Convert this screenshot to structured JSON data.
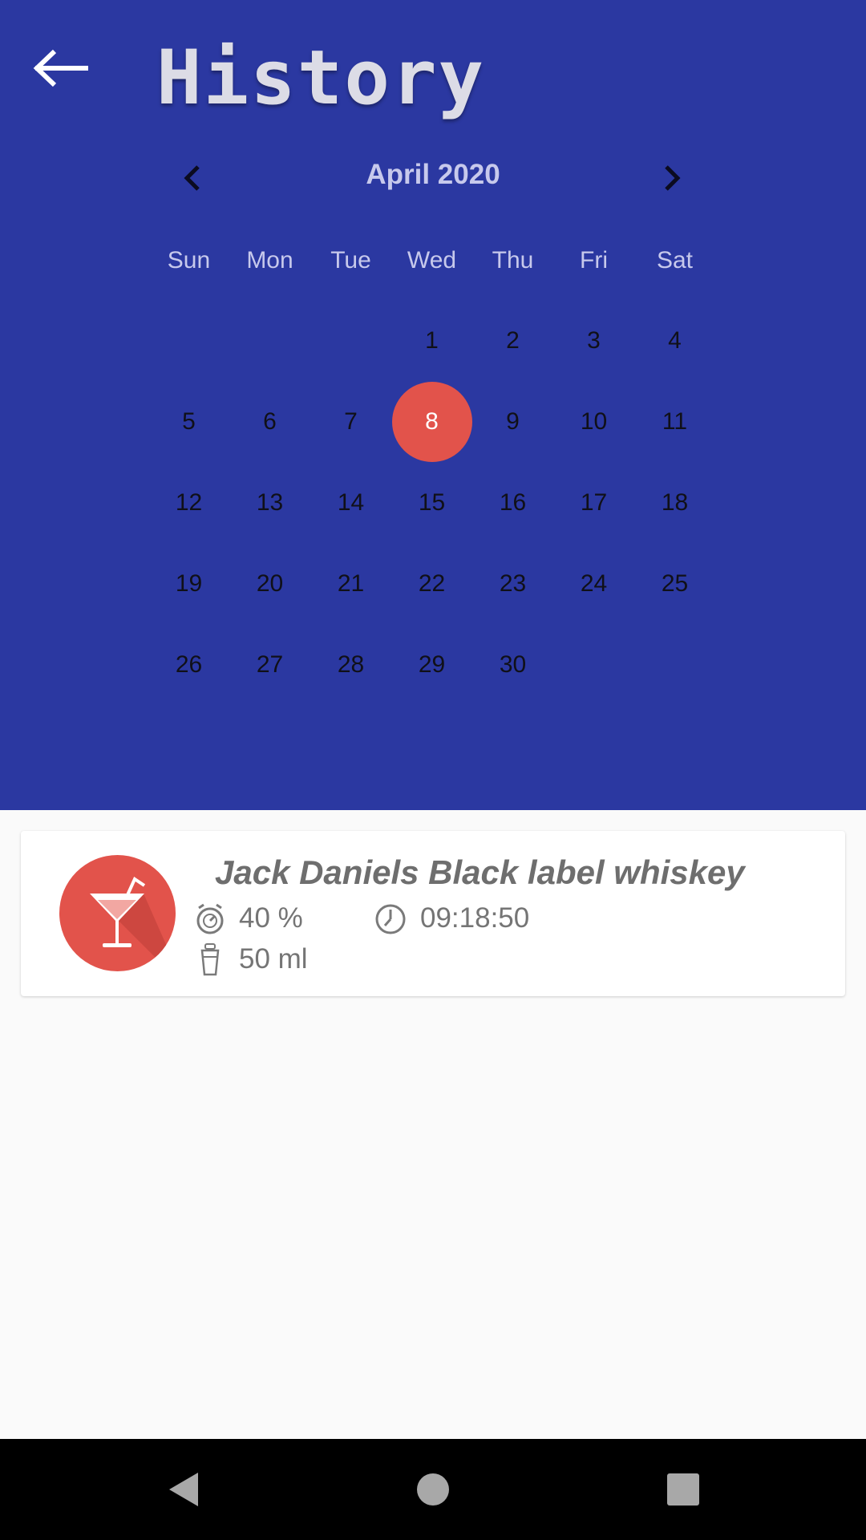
{
  "header": {
    "title": "History",
    "color": "#2b38a1"
  },
  "calendar": {
    "month_label": "April 2020",
    "weekdays": [
      "Sun",
      "Mon",
      "Tue",
      "Wed",
      "Thu",
      "Fri",
      "Sat"
    ],
    "days": [
      "",
      "",
      "",
      "1",
      "2",
      "3",
      "4",
      "5",
      "6",
      "7",
      "8",
      "9",
      "10",
      "11",
      "12",
      "13",
      "14",
      "15",
      "16",
      "17",
      "18",
      "19",
      "20",
      "21",
      "22",
      "23",
      "24",
      "25",
      "26",
      "27",
      "28",
      "29",
      "30",
      "",
      ""
    ],
    "selected_day": "8",
    "selected_color": "#e2534b"
  },
  "history": {
    "items": [
      {
        "name": "Jack Daniels Black label whiskey",
        "abv": "40 %",
        "time": "09:18:50",
        "volume": "50 ml",
        "icon": "cocktail-icon"
      }
    ]
  },
  "nav": {
    "icons": [
      "back-triangle-icon",
      "home-circle-icon",
      "recents-square-icon"
    ]
  }
}
